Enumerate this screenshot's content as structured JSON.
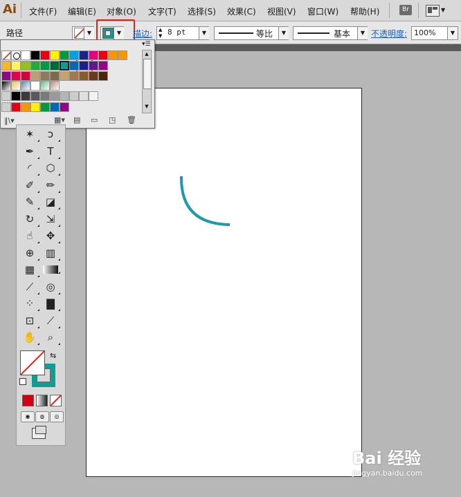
{
  "app": {
    "logo": "Ai"
  },
  "menu": {
    "items": [
      "文件(F)",
      "编辑(E)",
      "对象(O)",
      "文字(T)",
      "选择(S)",
      "效果(C)",
      "视图(V)",
      "窗口(W)",
      "帮助(H)"
    ],
    "bridge_label": "Br"
  },
  "control": {
    "object_type": "路径",
    "stroke_label": "描边:",
    "stroke_weight": "8 pt",
    "profile_uniform": "等比",
    "brush_basic": "基本",
    "opacity_label": "不透明度:",
    "opacity_value": "100%"
  },
  "swatches": {
    "selected_color": "#119b93",
    "row1": [
      "#ffffff",
      "#000000",
      "#e60012",
      "#fff100",
      "#009944",
      "#00a0e9",
      "#1d2088",
      "#e4007f",
      "#e60012",
      "#f39800",
      "#f39800"
    ],
    "row2": [
      "#f8b62d",
      "#fff45c",
      "#8fc31f",
      "#22ac38",
      "#009944",
      "#006934",
      "#119b93",
      "#0068b7",
      "#1d2088",
      "#601986",
      "#920783"
    ],
    "row3": [
      "#920783",
      "#e5004f",
      "#d7003a",
      "#bf9e77",
      "#8f7a5a",
      "#7d6a4a",
      "#c4a36f",
      "#a4784a",
      "#8b5a2b",
      "#6b3a1a",
      "#4b2510"
    ],
    "row4": [
      "#000000",
      "#3a3a3a",
      "#595959",
      "#7a7a7a",
      "#9a9a9a",
      "#b5b5b5",
      "#cccccc",
      "#e0e0e0",
      "#f2f2f2"
    ],
    "row5": [
      "#e60012",
      "#f39800",
      "#fff100",
      "#009944",
      "#0068b7",
      "#920783"
    ]
  },
  "canvas": {
    "arc_color": "#1d9aab"
  },
  "toolbox": {
    "icons": [
      "magic-wand-icon",
      "lasso-icon",
      "pen-icon",
      "type-icon",
      "arc-icon",
      "polygon-icon",
      "paintbrush-icon",
      "pencil-icon",
      "blob-brush-icon",
      "eraser-icon",
      "rotate-icon",
      "scale-icon",
      "warp-icon",
      "free-transform-icon",
      "shape-builder-icon",
      "perspective-grid-icon",
      "mesh-icon",
      "gradient-icon",
      "eyedropper-icon",
      "blend-icon",
      "symbol-sprayer-icon",
      "column-graph-icon",
      "artboard-icon",
      "slice-icon",
      "hand-icon",
      "zoom-icon"
    ],
    "stroke_color": "#0e9e94",
    "fill_state": "none"
  },
  "watermark": {
    "logo": "Bai 经验",
    "url": "jingyan.baidu.com"
  }
}
